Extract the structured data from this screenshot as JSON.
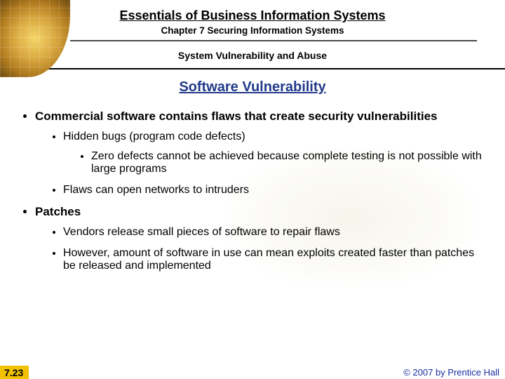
{
  "header": {
    "title": "Essentials of Business Information Systems",
    "chapter": "Chapter 7 Securing Information Systems",
    "subheader": "System Vulnerability and Abuse"
  },
  "topic": "Software Vulnerability",
  "bullets": {
    "b1": "Commercial software contains flaws that create security vulnerabilities",
    "b1a": "Hidden bugs (program code defects)",
    "b1a1": "Zero defects cannot be achieved because complete testing is not possible with large programs",
    "b1b": "Flaws can open networks to intruders",
    "b2": "Patches",
    "b2a": "Vendors release small pieces of software to repair flaws",
    "b2b": "However, amount of software in use can mean exploits created faster than patches be released and implemented"
  },
  "footer": {
    "page": "7.23",
    "copyright": "© 2007 by Prentice Hall"
  }
}
